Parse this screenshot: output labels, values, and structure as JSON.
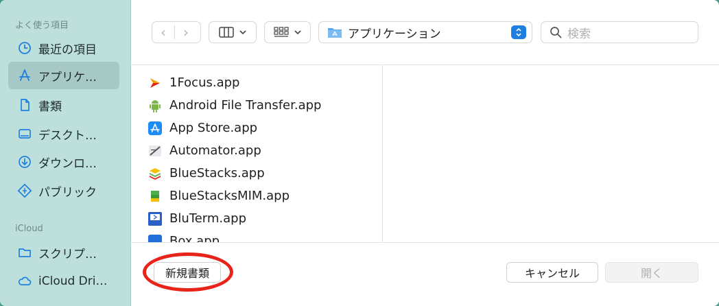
{
  "sidebar": {
    "favorites_header": "よく使う項目",
    "icloud_header": "iCloud",
    "favorites": [
      {
        "label": "最近の項目",
        "icon": "clock-icon"
      },
      {
        "label": "アプリケ…",
        "icon": "applications-icon",
        "selected": true
      },
      {
        "label": "書類",
        "icon": "document-icon"
      },
      {
        "label": "デスクト…",
        "icon": "desktop-icon"
      },
      {
        "label": "ダウンロ…",
        "icon": "download-icon"
      },
      {
        "label": "パブリック",
        "icon": "public-icon"
      }
    ],
    "icloud": [
      {
        "label": "スクリプ…",
        "icon": "folder-icon"
      },
      {
        "label": "iCloud Dri…",
        "icon": "cloud-icon"
      }
    ]
  },
  "toolbar": {
    "location": "アプリケーション",
    "search_placeholder": "検索"
  },
  "files": [
    {
      "name": "1Focus.app",
      "icon": "focus-app-icon"
    },
    {
      "name": "Android File Transfer.app",
      "icon": "android-icon"
    },
    {
      "name": "App Store.app",
      "icon": "app-store-icon"
    },
    {
      "name": "Automator.app",
      "icon": "automator-icon"
    },
    {
      "name": "BlueStacks.app",
      "icon": "bluestacks-icon"
    },
    {
      "name": "BlueStacksMIM.app",
      "icon": "bluestacks-mim-icon"
    },
    {
      "name": "BluTerm.app",
      "icon": "bluterm-icon"
    },
    {
      "name": "Box.app",
      "icon": "box-icon"
    }
  ],
  "buttons": {
    "new_document": "新規書類",
    "cancel": "キャンセル",
    "open": "開く"
  },
  "colors": {
    "sidebar_bg": "#bde0dc",
    "sidebar_selected": "#a6c9c6",
    "accent": "#1e7fe0",
    "highlight": "#e8231a"
  }
}
